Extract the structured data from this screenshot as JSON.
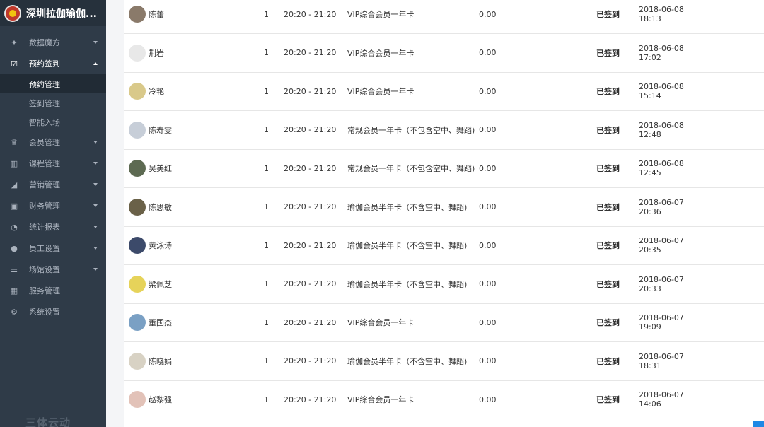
{
  "brand": {
    "title": "深圳拉伽瑜伽..."
  },
  "sidebar": {
    "items": [
      {
        "label": "数据魔方",
        "icon": "puzzle-icon"
      },
      {
        "label": "预约签到",
        "icon": "checkbox-icon",
        "open": true,
        "sub": [
          {
            "label": "预约管理",
            "active": true
          },
          {
            "label": "签到管理"
          },
          {
            "label": "智能入场"
          }
        ]
      },
      {
        "label": "会员管理",
        "icon": "crown-icon"
      },
      {
        "label": "课程管理",
        "icon": "books-icon"
      },
      {
        "label": "营销管理",
        "icon": "chart-icon"
      },
      {
        "label": "财务管理",
        "icon": "wallet-icon"
      },
      {
        "label": "统计报表",
        "icon": "pie-icon"
      },
      {
        "label": "员工设置",
        "icon": "user-icon"
      },
      {
        "label": "场馆设置",
        "icon": "sliders-icon"
      },
      {
        "label": "服务管理",
        "icon": "grid-icon"
      },
      {
        "label": "系统设置",
        "icon": "gear-icon"
      }
    ],
    "footer": "三体云动"
  },
  "rows": [
    {
      "name": "陈蕾",
      "count": "1",
      "time": "20:20 - 21:20",
      "card": "VIP综合会员一年卡",
      "amount": "0.00",
      "status": "已签到",
      "date": "2018-06-08",
      "clock": "18:13",
      "avatar_color": "#8a7a6a"
    },
    {
      "name": "荆岩",
      "count": "1",
      "time": "20:20 - 21:20",
      "card": "VIP综合会员一年卡",
      "amount": "0.00",
      "status": "已签到",
      "date": "2018-06-08",
      "clock": "17:02",
      "avatar_color": "#e8e8e8"
    },
    {
      "name": "冷艳",
      "count": "1",
      "time": "20:20 - 21:20",
      "card": "VIP综合会员一年卡",
      "amount": "0.00",
      "status": "已签到",
      "date": "2018-06-08",
      "clock": "15:14",
      "avatar_color": "#d9c98a"
    },
    {
      "name": "陈寿雯",
      "count": "1",
      "time": "20:20 - 21:20",
      "card": "常规会员一年卡（不包含空中、舞蹈)",
      "amount": "0.00",
      "status": "已签到",
      "date": "2018-06-08",
      "clock": "12:48",
      "avatar_color": "#c7ced8"
    },
    {
      "name": "吴美红",
      "count": "1",
      "time": "20:20 - 21:20",
      "card": "常规会员一年卡（不包含空中、舞蹈)",
      "amount": "0.00",
      "status": "已签到",
      "date": "2018-06-08",
      "clock": "12:45",
      "avatar_color": "#5d6a52"
    },
    {
      "name": "陈思敏",
      "count": "1",
      "time": "20:20 - 21:20",
      "card": "瑜伽会员半年卡（不含空中、舞蹈)",
      "amount": "0.00",
      "status": "已签到",
      "date": "2018-06-07",
      "clock": "20:36",
      "avatar_color": "#6a6148"
    },
    {
      "name": "黄泳诗",
      "count": "1",
      "time": "20:20 - 21:20",
      "card": "瑜伽会员半年卡（不含空中、舞蹈)",
      "amount": "0.00",
      "status": "已签到",
      "date": "2018-06-07",
      "clock": "20:35",
      "avatar_color": "#3c4a6a"
    },
    {
      "name": "梁佩芝",
      "count": "1",
      "time": "20:20 - 21:20",
      "card": "瑜伽会员半年卡（不含空中、舞蹈)",
      "amount": "0.00",
      "status": "已签到",
      "date": "2018-06-07",
      "clock": "20:33",
      "avatar_color": "#e6d35a"
    },
    {
      "name": "董国杰",
      "count": "1",
      "time": "20:20 - 21:20",
      "card": "VIP综合会员一年卡",
      "amount": "0.00",
      "status": "已签到",
      "date": "2018-06-07",
      "clock": "19:09",
      "avatar_color": "#7aa0c4"
    },
    {
      "name": "陈晓娟",
      "count": "1",
      "time": "20:20 - 21:20",
      "card": "瑜伽会员半年卡（不含空中、舞蹈)",
      "amount": "0.00",
      "status": "已签到",
      "date": "2018-06-07",
      "clock": "18:31",
      "avatar_color": "#d8d2c4"
    },
    {
      "name": "赵黎强",
      "count": "1",
      "time": "20:20 - 21:20",
      "card": "VIP综合会员一年卡",
      "amount": "0.00",
      "status": "已签到",
      "date": "2018-06-07",
      "clock": "14:06",
      "avatar_color": "#e2c2b8"
    }
  ],
  "colors": {
    "sidebar_bg": "#2f3b48",
    "sidebar_active": "#212b35",
    "accent": "#1e88e5"
  }
}
